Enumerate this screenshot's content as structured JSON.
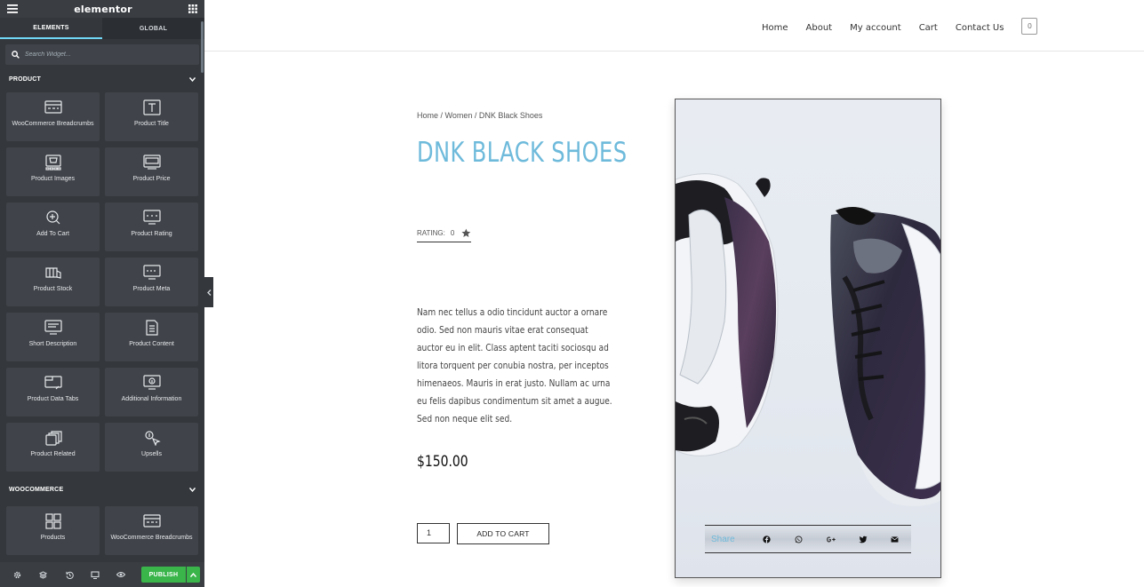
{
  "panel": {
    "logo": "elementor",
    "tabs": [
      "ELEMENTS",
      "GLOBAL"
    ],
    "search_placeholder": "Search Widget...",
    "categories": [
      {
        "label": "PRODUCT",
        "widgets": [
          {
            "label": "WooCommerce Breadcrumbs",
            "icon": "breadcrumbs-icon"
          },
          {
            "label": "Product Title",
            "icon": "title-icon"
          },
          {
            "label": "Product Images",
            "icon": "images-icon"
          },
          {
            "label": "Product Price",
            "icon": "price-icon"
          },
          {
            "label": "Add To Cart",
            "icon": "add-to-cart-icon"
          },
          {
            "label": "Product Rating",
            "icon": "rating-icon"
          },
          {
            "label": "Product Stock",
            "icon": "stock-icon"
          },
          {
            "label": "Product Meta",
            "icon": "meta-icon"
          },
          {
            "label": "Short Description",
            "icon": "short-description-icon"
          },
          {
            "label": "Product Content",
            "icon": "content-icon"
          },
          {
            "label": "Product Data Tabs",
            "icon": "data-tabs-icon"
          },
          {
            "label": "Additional Information",
            "icon": "info-icon"
          },
          {
            "label": "Product Related",
            "icon": "related-icon"
          },
          {
            "label": "Upsells",
            "icon": "upsells-icon"
          }
        ]
      },
      {
        "label": "WOOCOMMERCE",
        "widgets": [
          {
            "label": "Products",
            "icon": "products-icon"
          },
          {
            "label": "WooCommerce Breadcrumbs",
            "icon": "breadcrumbs-icon"
          }
        ]
      }
    ],
    "publish_label": "PUBLISH",
    "accent_color": "#71d7f7",
    "publish_color": "#39b54a"
  },
  "site": {
    "nav": [
      "Home",
      "About",
      "My account",
      "Cart",
      "Contact Us"
    ],
    "cart_count": "0",
    "breadcrumb": "Home / Women / DNK Black Shoes",
    "product_title": "DNK BLACK SHOES",
    "rating_label": "RATING:",
    "rating_value": "0",
    "description": "Nam nec tellus a odio tincidunt auctor a ornare odio. Sed non mauris vitae erat consequat auctor eu in elit. Class aptent taciti sociosqu ad litora torquent per conubia nostra, per inceptos himenaeos. Mauris in erat justo. Nullam ac urna eu felis dapibus condimentum sit amet a augue. Sed non neque elit sed.",
    "price": "$150.00",
    "quantity": "1",
    "add_to_cart_label": "ADD TO CART",
    "share_label": "Share",
    "share_icons": [
      "facebook-icon",
      "whatsapp-icon",
      "google-plus-icon",
      "twitter-icon",
      "email-icon"
    ],
    "title_color": "#6ebadb"
  }
}
